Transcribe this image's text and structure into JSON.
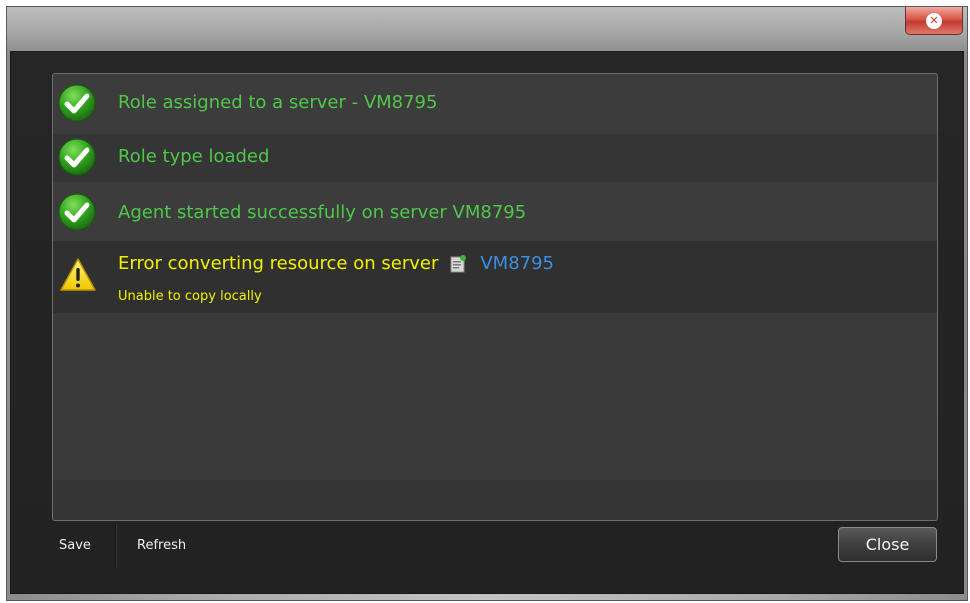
{
  "window": {
    "close_glyph": "✕"
  },
  "messages": [
    {
      "status": "success",
      "icon": "check-circle-icon",
      "text": "Role assigned to a server - VM8795"
    },
    {
      "status": "success",
      "icon": "check-circle-icon",
      "text": "Role type loaded"
    },
    {
      "status": "success",
      "icon": "check-circle-icon",
      "text": "Agent started successfully on server VM8795"
    },
    {
      "status": "warning",
      "icon": "warning-triangle-icon",
      "text": "Error converting resource on server",
      "server_icon": "server-icon",
      "server_link": "VM8795",
      "detail": "Unable to copy locally"
    }
  ],
  "footer": {
    "save_label": "Save",
    "refresh_label": "Refresh",
    "close_label": "Close"
  },
  "colors": {
    "success_text": "#4fc84a",
    "warning_text": "#f2f200",
    "link_text": "#3c8fde",
    "panel_bg": "#3a3a3a",
    "client_bg": "#262626"
  }
}
